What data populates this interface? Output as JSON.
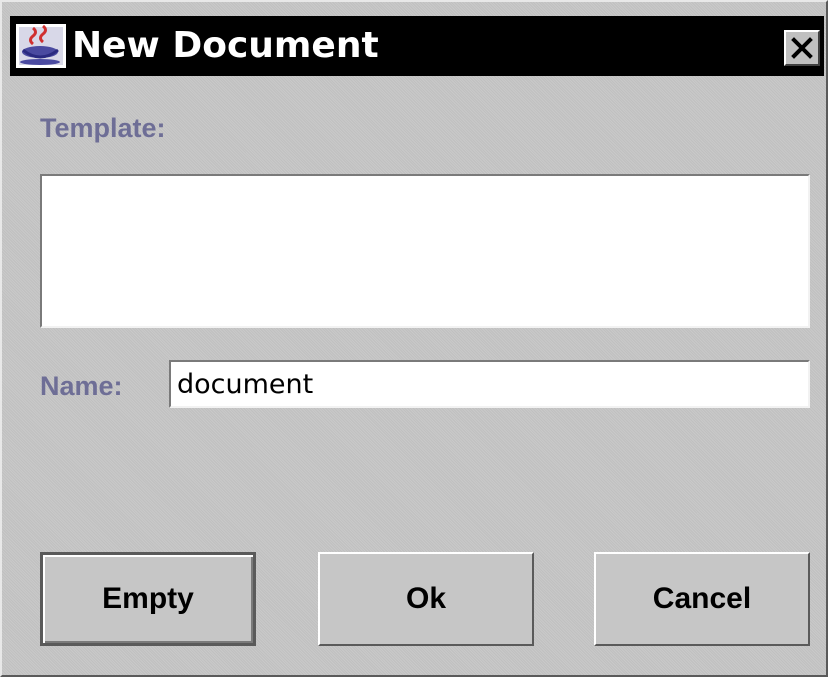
{
  "window": {
    "title": "New Document"
  },
  "icons": {
    "app": "java-app-icon",
    "close": "close-icon"
  },
  "form": {
    "template_label": "Template:",
    "name_label": "Name:",
    "name_value": "document",
    "template_items": []
  },
  "buttons": {
    "empty_label": "Empty",
    "ok_label": "Ok",
    "cancel_label": "Cancel"
  },
  "colors": {
    "titlebar": "#000000",
    "title_text": "#ffffff",
    "label_text": "#6e6e96",
    "background": "#c6c6c6"
  }
}
